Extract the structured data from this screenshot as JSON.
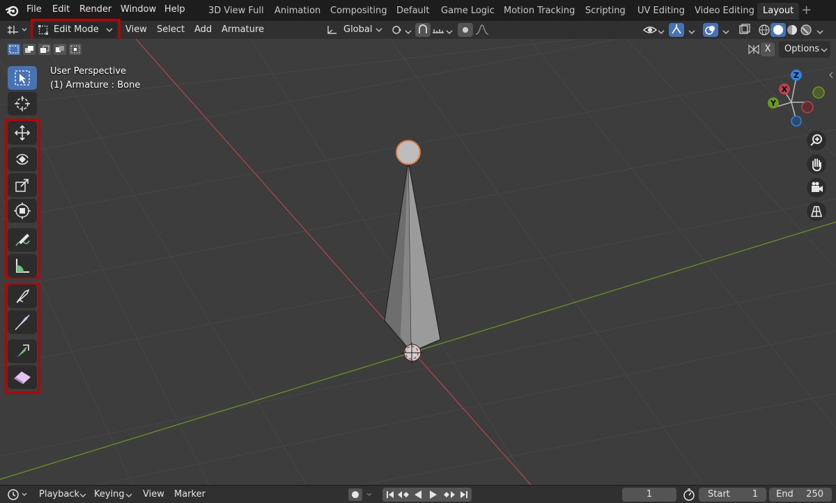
{
  "topbar": {
    "menus": [
      "File",
      "Edit",
      "Render",
      "Window",
      "Help"
    ],
    "workspaces": [
      "3D View Full",
      "Animation",
      "Compositing",
      "Default",
      "Game Logic",
      "Motion Tracking",
      "Scripting",
      "UV Editing",
      "Video Editing",
      "Layout"
    ],
    "active_workspace": "Layout",
    "add_tab": "+"
  },
  "header": {
    "mode": "Edit Mode",
    "menus": [
      "View",
      "Select",
      "Add",
      "Armature"
    ],
    "orientation": "Global",
    "options_label": "Options",
    "x_label": "X"
  },
  "viewport": {
    "perspective_label": "User Perspective",
    "object_label": "(1) Armature : Bone"
  },
  "gizmo": {
    "z": "Z",
    "x": "X",
    "y": "Y"
  },
  "timeline": {
    "playback": "Playback",
    "keying": "Keying",
    "view": "View",
    "marker": "Marker",
    "current_frame": "1",
    "start_label": "Start",
    "start_value": "1",
    "end_label": "End",
    "end_value": "250"
  },
  "colors": {
    "highlight": "#c00000",
    "active_tool": "#4772b3",
    "x_axis": "#b8434f",
    "y_axis": "#6b9a1f",
    "z_axis": "#2f83e3"
  }
}
